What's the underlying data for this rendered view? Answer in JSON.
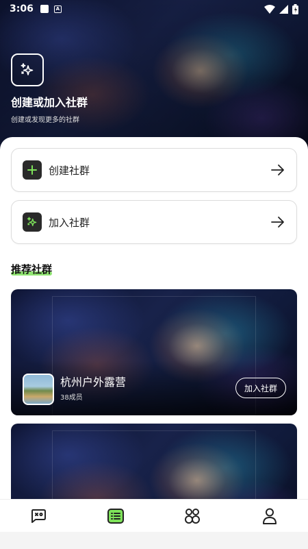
{
  "status_bar": {
    "time": "3:06",
    "notification_letter": "A"
  },
  "header": {
    "icon": "sparkle-icon",
    "title": "创建或加入社群",
    "subtitle": "创建或发现更多的社群"
  },
  "actions": [
    {
      "label": "创建社群",
      "icon": "plus-icon"
    },
    {
      "label": "加入社群",
      "icon": "sparkle-icon"
    }
  ],
  "recommended": {
    "title": "推荐社群",
    "communities": [
      {
        "name": "杭州户外露营",
        "members": "38成员",
        "join_label": "加入社群"
      }
    ]
  },
  "bottom_nav": {
    "items": [
      {
        "icon": "chat-face-icon",
        "active": false
      },
      {
        "icon": "list-icon",
        "active": true
      },
      {
        "icon": "community-icon",
        "active": false
      },
      {
        "icon": "profile-icon",
        "active": false
      }
    ]
  },
  "colors": {
    "accent": "#7ee25a",
    "dark": "#2a2a2a",
    "background": "#ffffff"
  }
}
